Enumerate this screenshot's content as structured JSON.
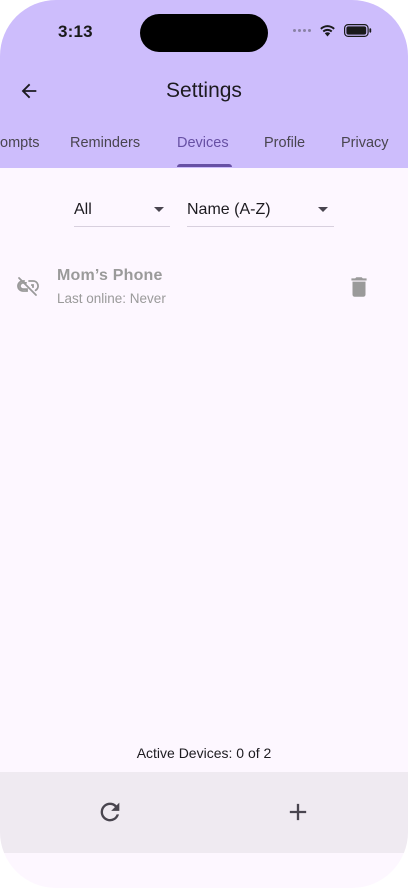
{
  "status_bar": {
    "time": "3:13",
    "icons": [
      "signal-dots-icon",
      "wifi-icon",
      "battery-icon"
    ]
  },
  "app_bar": {
    "title": "Settings",
    "back_icon": "arrow-left-icon"
  },
  "tabs": [
    {
      "label": "ompts",
      "active": false
    },
    {
      "label": "Reminders",
      "active": false
    },
    {
      "label": "Devices",
      "active": true
    },
    {
      "label": "Profile",
      "active": false
    },
    {
      "label": "Privacy",
      "active": false
    }
  ],
  "filters": {
    "status_value": "All",
    "sort_value": "Name (A-Z)"
  },
  "devices": [
    {
      "name": "Mom’s Phone",
      "subtitle": "Last online: Never",
      "status_icon": "link-off-icon",
      "action_icon": "trash-icon"
    }
  ],
  "footer": {
    "active_count": "Active Devices: 0 of 2",
    "refresh_icon": "refresh-icon",
    "add_icon": "plus-icon"
  },
  "colors": {
    "header_bg": "#cdbdfc",
    "page_bg": "#fdf7ff",
    "accent": "#6750a4",
    "bottom_bar_bg": "#efeaf1",
    "muted_text": "#9a9a9a"
  }
}
